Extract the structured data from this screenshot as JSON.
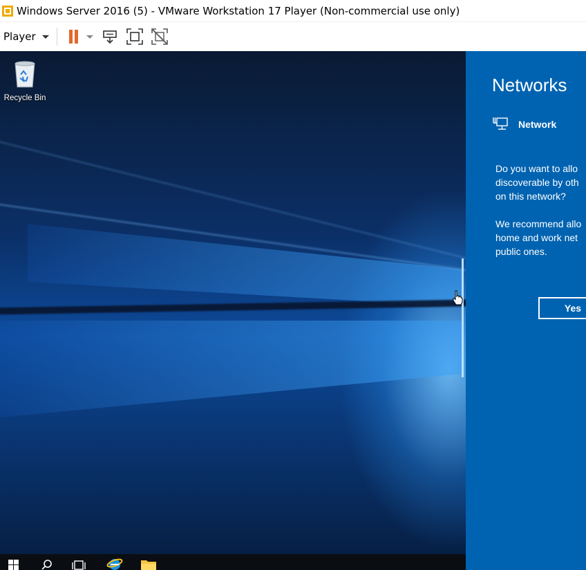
{
  "window": {
    "title": "Windows Server 2016 (5) - VMware Workstation 17 Player (Non-commercial use only)"
  },
  "toolbar": {
    "player_label": "Player",
    "icons": [
      "pause-icon",
      "send-ctrl-alt-del-icon",
      "fit-guest-icon",
      "unity-disabled-icon"
    ]
  },
  "desktop": {
    "icons": [
      {
        "label": "Recycle Bin",
        "icon": "recycle-bin-icon"
      }
    ]
  },
  "taskbar": {
    "items": [
      "start-icon",
      "search-icon",
      "task-view-icon",
      "internet-explorer-icon",
      "file-explorer-icon"
    ]
  },
  "networks_panel": {
    "title": "Networks",
    "network_name": "Network",
    "question_lines": [
      "Do you want to allo",
      "discoverable by oth",
      "on this network?"
    ],
    "recommend_lines": [
      "We recommend allo",
      "home and work net",
      "public ones."
    ],
    "yes_label": "Yes"
  },
  "colors": {
    "flyout_bg": "#0063b1",
    "pause_orange": "#e4682a",
    "taskbar_bg": "#0a0d12"
  }
}
